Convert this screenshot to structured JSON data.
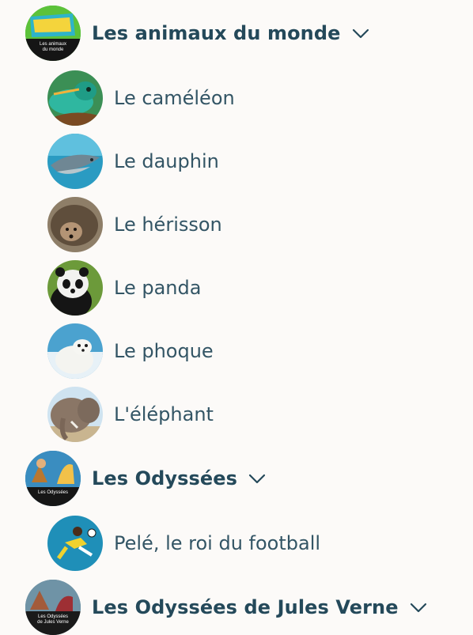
{
  "series": [
    {
      "title": "Les animaux du monde",
      "thumb_lines": [
        "Les animaux",
        "du monde"
      ],
      "episodes": [
        "Le caméléon",
        "Le dauphin",
        "Le hérisson",
        "Le panda",
        "Le phoque",
        "L'éléphant"
      ]
    },
    {
      "title": "Les Odyssées",
      "thumb_lines": [
        "Les Odyssées"
      ],
      "episodes": [
        "Pelé, le roi du football"
      ]
    },
    {
      "title": "Les Odyssées de Jules Verne",
      "thumb_lines": [
        "Les Odyssées",
        "de Jules Verne"
      ],
      "episodes": []
    }
  ],
  "icons": {
    "expand": "chevron-down-icon"
  },
  "colors": {
    "background": "#fcfaf8",
    "series_text": "#24495a",
    "episode_text": "#335565",
    "chevron": "#24495a"
  }
}
